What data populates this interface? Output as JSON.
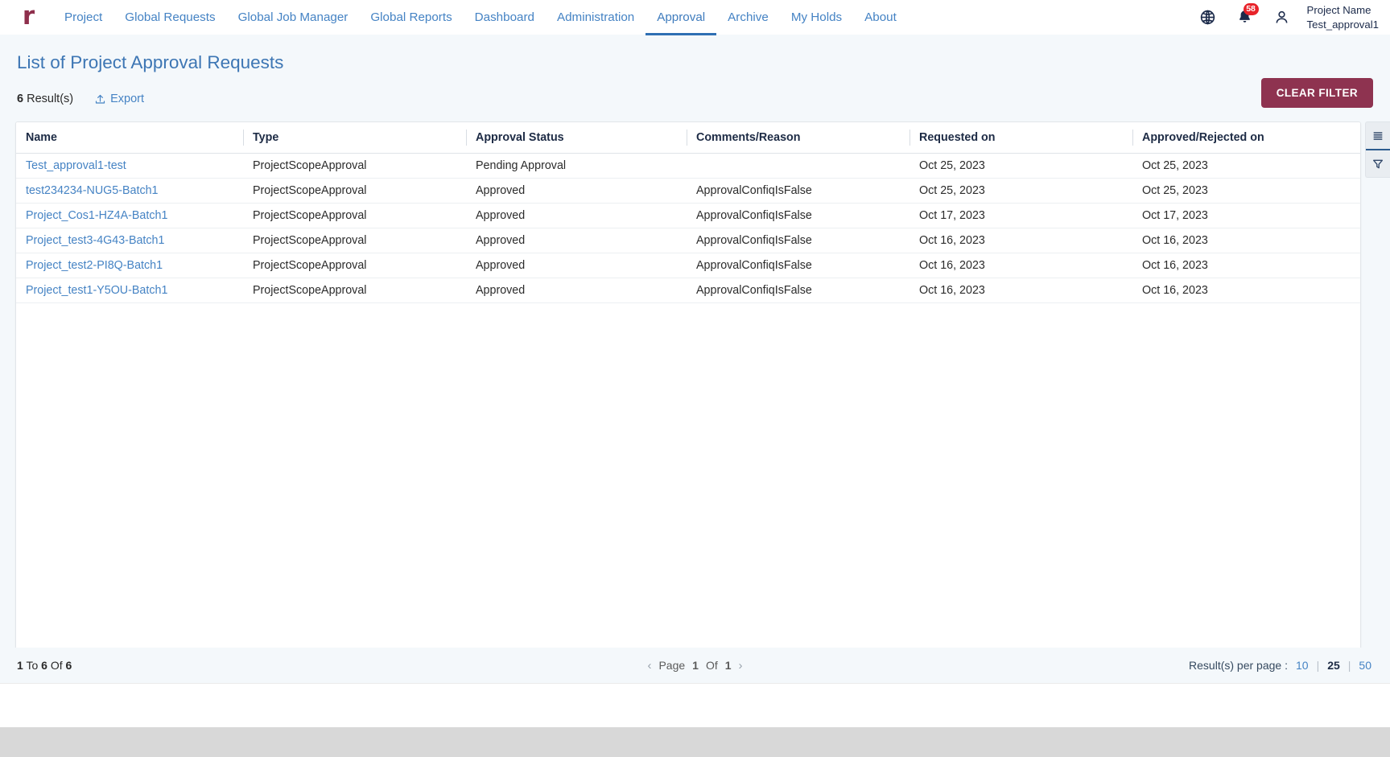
{
  "header": {
    "logo": "r",
    "nav": [
      {
        "label": "Project",
        "active": false
      },
      {
        "label": "Global Requests",
        "active": false
      },
      {
        "label": "Global Job Manager",
        "active": false
      },
      {
        "label": "Global Reports",
        "active": false
      },
      {
        "label": "Dashboard",
        "active": false
      },
      {
        "label": "Administration",
        "active": false
      },
      {
        "label": "Approval",
        "active": true
      },
      {
        "label": "Archive",
        "active": false
      },
      {
        "label": "My Holds",
        "active": false
      },
      {
        "label": "About",
        "active": false
      }
    ],
    "icons": {
      "globe": "globe-icon",
      "notifications": "bell-icon",
      "user": "user-icon"
    },
    "notification_count": "58",
    "project_label": "Project Name",
    "project_name": "Test_approval1"
  },
  "page": {
    "title": "List of Project Approval Requests",
    "result_count_number": "6",
    "result_count_suffix": " Result(s)",
    "export_label": "Export",
    "clear_filter_label": "CLEAR FILTER"
  },
  "table": {
    "columns": [
      "Name",
      "Type",
      "Approval Status",
      "Comments/Reason",
      "Requested on",
      "Approved/Rejected on"
    ],
    "rows": [
      {
        "name": "Test_approval1-test",
        "type": "ProjectScopeApproval",
        "status": "Pending Approval",
        "comments": "",
        "requested_on": "Oct 25, 2023",
        "decided_on": "Oct 25, 2023"
      },
      {
        "name": "test234234-NUG5-Batch1",
        "type": "ProjectScopeApproval",
        "status": "Approved",
        "comments": "ApprovalConfiqIsFalse",
        "requested_on": "Oct 25, 2023",
        "decided_on": "Oct 25, 2023"
      },
      {
        "name": "Project_Cos1-HZ4A-Batch1",
        "type": "ProjectScopeApproval",
        "status": "Approved",
        "comments": "ApprovalConfiqIsFalse",
        "requested_on": "Oct 17, 2023",
        "decided_on": "Oct 17, 2023"
      },
      {
        "name": "Project_test3-4G43-Batch1",
        "type": "ProjectScopeApproval",
        "status": "Approved",
        "comments": "ApprovalConfiqIsFalse",
        "requested_on": "Oct 16, 2023",
        "decided_on": "Oct 16, 2023"
      },
      {
        "name": "Project_test2-PI8Q-Batch1",
        "type": "ProjectScopeApproval",
        "status": "Approved",
        "comments": "ApprovalConfiqIsFalse",
        "requested_on": "Oct 16, 2023",
        "decided_on": "Oct 16, 2023"
      },
      {
        "name": "Project_test1-Y5OU-Batch1",
        "type": "ProjectScopeApproval",
        "status": "Approved",
        "comments": "ApprovalConfiqIsFalse",
        "requested_on": "Oct 16, 2023",
        "decided_on": "Oct 16, 2023"
      }
    ]
  },
  "right_rail": {
    "columns_icon": "list-lines-icon",
    "filter_icon": "funnel-filter-icon"
  },
  "pager": {
    "range_from": "1",
    "range_to_label": "To",
    "range_to": "6",
    "range_of_label": "Of",
    "range_total": "6",
    "page_label": "Page",
    "page_current": "1",
    "page_of_label": "Of",
    "page_total": "1",
    "prev_icon": "chevron-left-icon",
    "next_icon": "chevron-right-icon",
    "per_page_label": "Result(s) per page :",
    "per_page_options": [
      "10",
      "25",
      "50"
    ],
    "per_page_selected": "25"
  },
  "colors": {
    "brand": "#8e3350",
    "link": "#4583c4",
    "accent_underline": "#2f6fb3",
    "badge": "#e8232a",
    "page_bg": "#f4f8fb"
  }
}
